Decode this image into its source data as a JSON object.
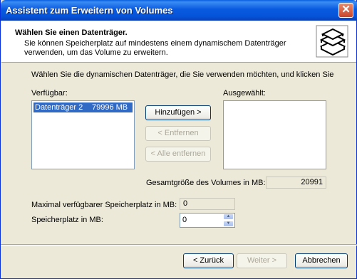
{
  "window": {
    "title": "Assistent zum Erweitern von Volumes",
    "close_glyph": "✕"
  },
  "header": {
    "title": "Wählen Sie einen Datenträger.",
    "description": "Sie können Speicherplatz auf mindestens einem dynamischem Datenträger verwenden, um das Volume zu erweitern.",
    "icon": "disks-icon"
  },
  "instruction": "Wählen Sie die dynamischen Datenträger, die Sie verwenden möchten, und klicken Sie",
  "available": {
    "label": "Verfügbar:",
    "items": [
      {
        "name": "Datenträger 2",
        "size": "79996 MB"
      }
    ]
  },
  "selected": {
    "label": "Ausgewählt:",
    "items": []
  },
  "buttons": {
    "add": "Hinzufügen >",
    "remove": "< Entfernen",
    "remove_all": "< Alle entfernen",
    "back": "< Zurück",
    "next": "Weiter >",
    "cancel": "Abbrechen"
  },
  "total_size": {
    "label": "Gesamtgröße des Volumes in MB:",
    "value": "20991"
  },
  "max_space": {
    "label": "Maximal verfügbarer Speicherplatz in MB:",
    "value": "0"
  },
  "space": {
    "label": "Speicherplatz in MB:",
    "value": "0"
  }
}
